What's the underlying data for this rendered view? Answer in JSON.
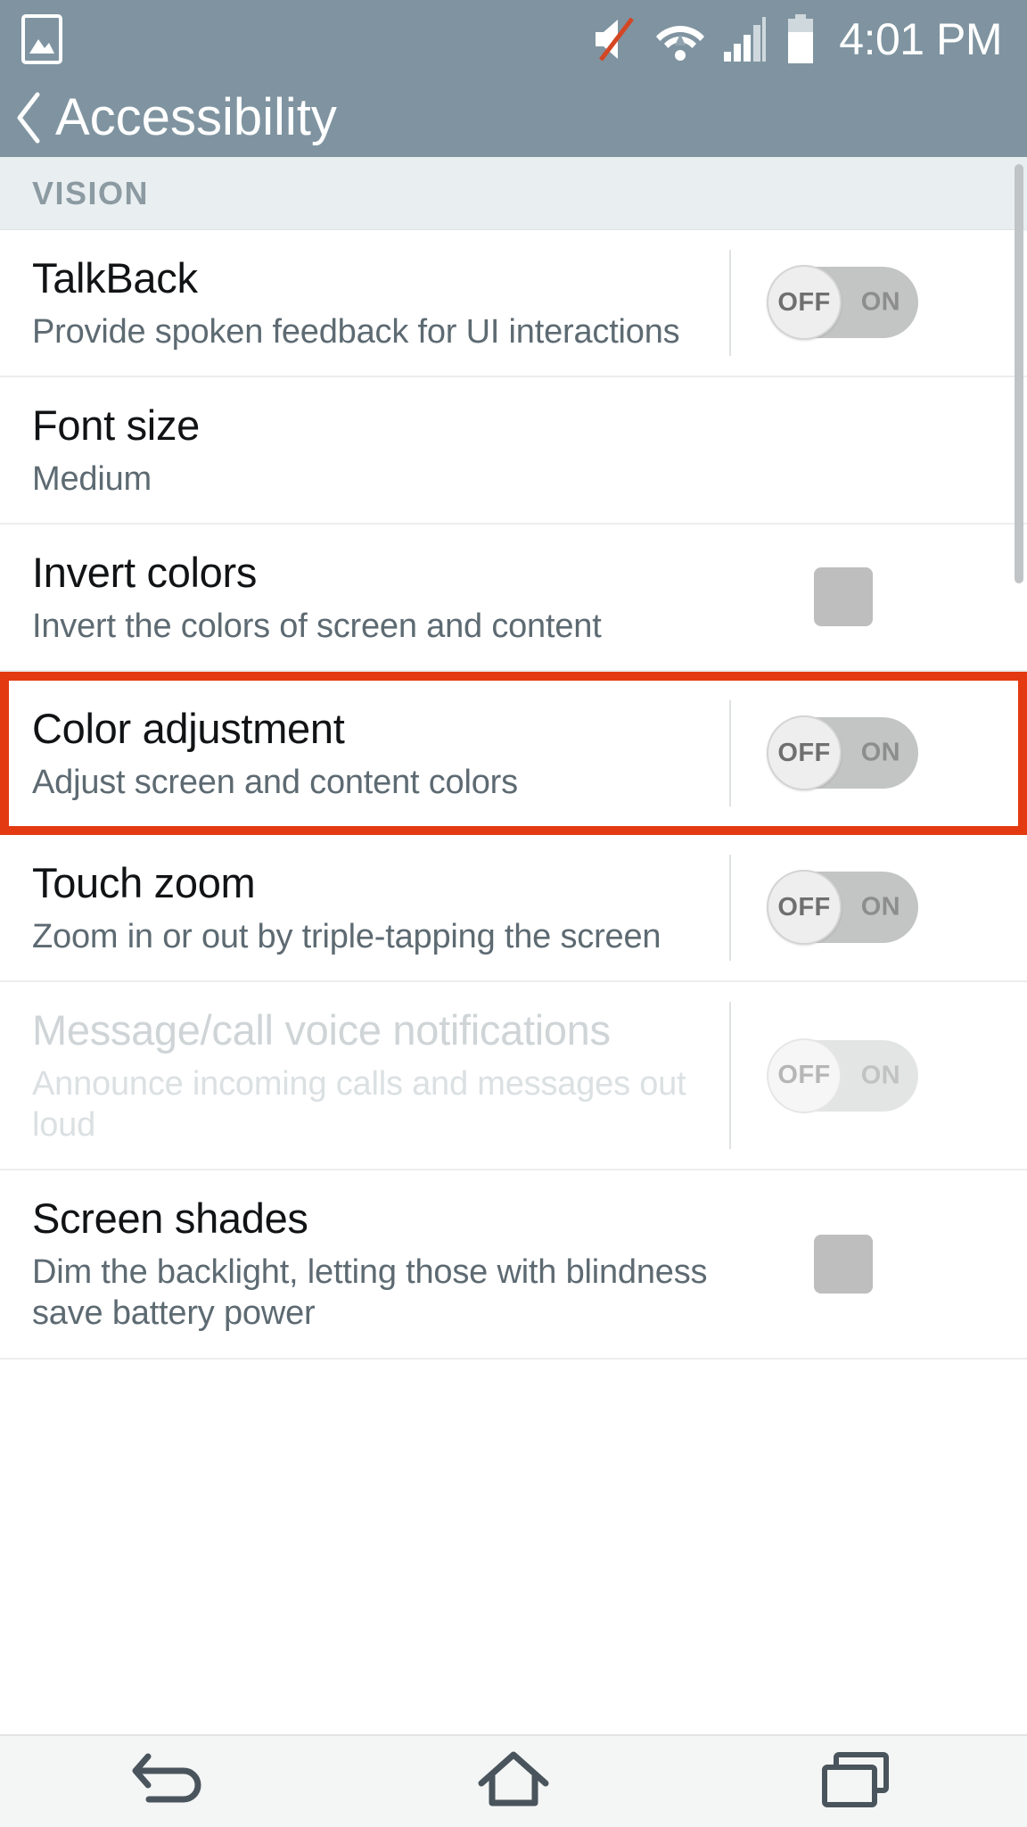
{
  "statusbar": {
    "time": "4:01 PM",
    "icons": [
      {
        "name": "gallery-icon"
      },
      {
        "name": "sound-muted-icon"
      },
      {
        "name": "wifi-icon"
      },
      {
        "name": "cellular-signal-icon"
      },
      {
        "name": "battery-icon"
      }
    ],
    "background_color": "#7f94a0"
  },
  "actionbar": {
    "back_label": "‹",
    "title": "Accessibility"
  },
  "sections": [
    {
      "header": "VISION",
      "rows": [
        {
          "title": "TalkBack",
          "subtitle": "Provide spoken feedback for UI interactions",
          "control": "toggle",
          "toggle_off_label": "OFF",
          "toggle_on_label": "ON",
          "value": "OFF",
          "disabled": false,
          "highlighted": false
        },
        {
          "title": "Font size",
          "subtitle": "Medium",
          "control": "none",
          "disabled": false,
          "highlighted": false
        },
        {
          "title": "Invert colors",
          "subtitle": "Invert the colors of screen and content",
          "control": "checkbox",
          "value": "unchecked",
          "disabled": false,
          "highlighted": false
        },
        {
          "title": "Color adjustment",
          "subtitle": "Adjust screen and content colors",
          "control": "toggle",
          "toggle_off_label": "OFF",
          "toggle_on_label": "ON",
          "value": "OFF",
          "disabled": false,
          "highlighted": true
        },
        {
          "title": "Touch zoom",
          "subtitle": "Zoom in or out by triple-tapping the screen",
          "control": "toggle",
          "toggle_off_label": "OFF",
          "toggle_on_label": "ON",
          "value": "OFF",
          "disabled": false,
          "highlighted": false
        },
        {
          "title": "Message/call voice notifications",
          "subtitle": "Announce incoming calls and messages out loud",
          "control": "toggle",
          "toggle_off_label": "OFF",
          "toggle_on_label": "ON",
          "value": "OFF",
          "disabled": true,
          "highlighted": false
        },
        {
          "title": "Screen shades",
          "subtitle": "Dim the backlight, letting those with blindness save battery power",
          "control": "checkbox",
          "value": "unchecked",
          "disabled": false,
          "highlighted": false
        }
      ]
    }
  ],
  "navbar": {
    "buttons": [
      {
        "name": "back-nav-button"
      },
      {
        "name": "home-nav-button"
      },
      {
        "name": "recents-nav-button"
      }
    ]
  },
  "colors": {
    "header_bg": "#7f94a0",
    "section_bg": "#e9eff1",
    "highlight": "#e33a12",
    "toggle_track": "#c3c4c4",
    "checkbox": "#bebebe",
    "nav_icon": "#49545c"
  }
}
